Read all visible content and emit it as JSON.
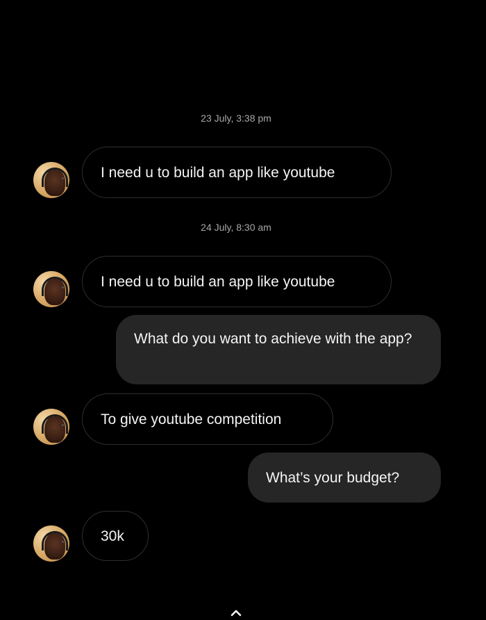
{
  "thread": {
    "timestamps": [
      "23 July, 3:38 pm",
      "24 July, 8:30 am"
    ],
    "messages": [
      {
        "from": "them",
        "text": "I need u to build an app like youtube"
      },
      {
        "from": "them",
        "text": "I need u to build an app like youtube"
      },
      {
        "from": "me",
        "text": "What do you want to achieve with the app?"
      },
      {
        "from": "them",
        "text": "To give youtube competition"
      },
      {
        "from": "me",
        "text": "What’s your budget?"
      },
      {
        "from": "them",
        "text": "30k"
      }
    ]
  },
  "icons": {
    "scroll_up": "chevron-up-icon",
    "avatar": "contact-avatar"
  },
  "colors": {
    "background": "#000000",
    "incoming_border": "#2e2e2e",
    "outgoing_bg": "#262626",
    "timestamp": "#a8a8a8",
    "text": "#f5f5f5"
  }
}
